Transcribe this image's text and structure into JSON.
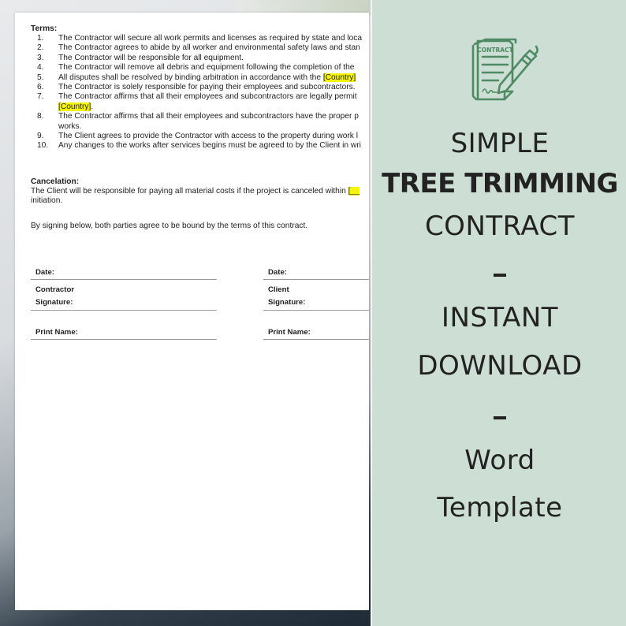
{
  "document": {
    "terms_heading": "Terms:",
    "terms": [
      {
        "num": "1.",
        "text": "The Contractor will secure all work permits and licenses as required by state and loca"
      },
      {
        "num": "2.",
        "text": "The Contractor agrees to abide by all worker and environmental safety laws and stan"
      },
      {
        "num": "3.",
        "text": "The Contractor will be responsible for all equipment."
      },
      {
        "num": "4.",
        "text": "The Contractor will remove all debris and equipment following the completion of the"
      },
      {
        "num": "5.",
        "text": "All disputes shall be resolved by binding arbitration in accordance with the ",
        "highlight": "[Country]"
      },
      {
        "num": "6.",
        "text": "The Contractor is solely responsible for paying their employees and subcontractors."
      },
      {
        "num": "7.",
        "text": "The Contractor affirms that all their employees and subcontractors are legally permit",
        "continuation_highlight": "[Country]",
        "continuation_tail": "."
      },
      {
        "num": "8.",
        "text": "The Contractor affirms that all their employees and subcontractors have the proper p",
        "continuation": "works."
      },
      {
        "num": "9.",
        "text": "The Client agrees to provide the Contractor with access to the property during work l"
      },
      {
        "num": "10.",
        "text": "Any changes to the works after services begins must be agreed to by the Client in wri"
      }
    ],
    "cancelation_heading": "Cancelation:",
    "cancelation_text": "The Client will be responsible for paying all material costs if the project is canceled within ",
    "cancelation_highlight": "[__",
    "cancelation_continuation": "initiation.",
    "agreement_text": "By signing below, both parties agree to be bound by the terms of this contract.",
    "signature_block": {
      "left": {
        "date": "Date:",
        "party": "Contractor",
        "signature": "Signature:",
        "print_name": "Print Name:"
      },
      "right": {
        "date": "Date:",
        "party": "Client",
        "signature": "Signature:",
        "print_name": "Print Name:"
      }
    }
  },
  "promo": {
    "icon": "contract-document-pen-icon",
    "icon_label": "CONTRACT",
    "line1": "SIMPLE",
    "line2": "TREE TRIMMING",
    "line3": "CONTRACT",
    "separator1": "-",
    "line4": "INSTANT",
    "line5": "DOWNLOAD",
    "separator2": "-",
    "line6": "Word",
    "line7": "Template"
  },
  "colors": {
    "panel_bg": "#cddfd5",
    "icon_green": "#4e8a63",
    "highlight": "#f5f500",
    "text_dark": "#222222"
  }
}
